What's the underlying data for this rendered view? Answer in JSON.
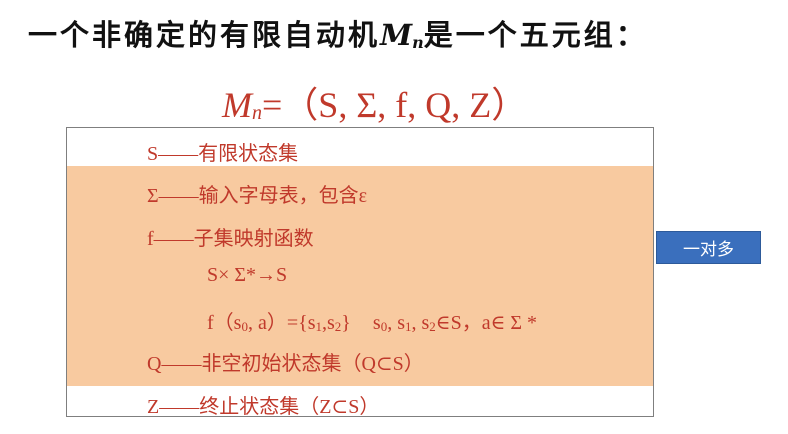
{
  "heading": {
    "prefix": "一个非确定的有限自动机",
    "m": "M",
    "sub": "n",
    "suffix": "是一个五元组："
  },
  "formula": {
    "m": "M",
    "sub": "n",
    "rest": "=（S, Σ, f, Q, Z）"
  },
  "rows": {
    "s": "S——有限状态集",
    "sigma": "Σ——输入字母表，包含ε",
    "f": "f——子集映射函数",
    "mapping": "S× Σ*→S",
    "example": {
      "p1": "f（s",
      "s0": "0",
      "p2": ", a）={s",
      "s1": "1",
      "p3": ",s",
      "s2": "2",
      "p4": "}",
      "q1": "s",
      "qs0": "0",
      "q2": ", s",
      "qs1": "1",
      "q3": ", s",
      "qs2": "2",
      "q4": "∈S，a∈ Σ *"
    },
    "q": "Q——非空初始状态集（Q⊂S）",
    "z": "Z——终止状态集（Z⊂S）"
  },
  "badge": {
    "label": "一对多"
  },
  "colors": {
    "accent": "#c0392b",
    "highlight": "#f8caa0",
    "badge": "#3a6fbd"
  }
}
